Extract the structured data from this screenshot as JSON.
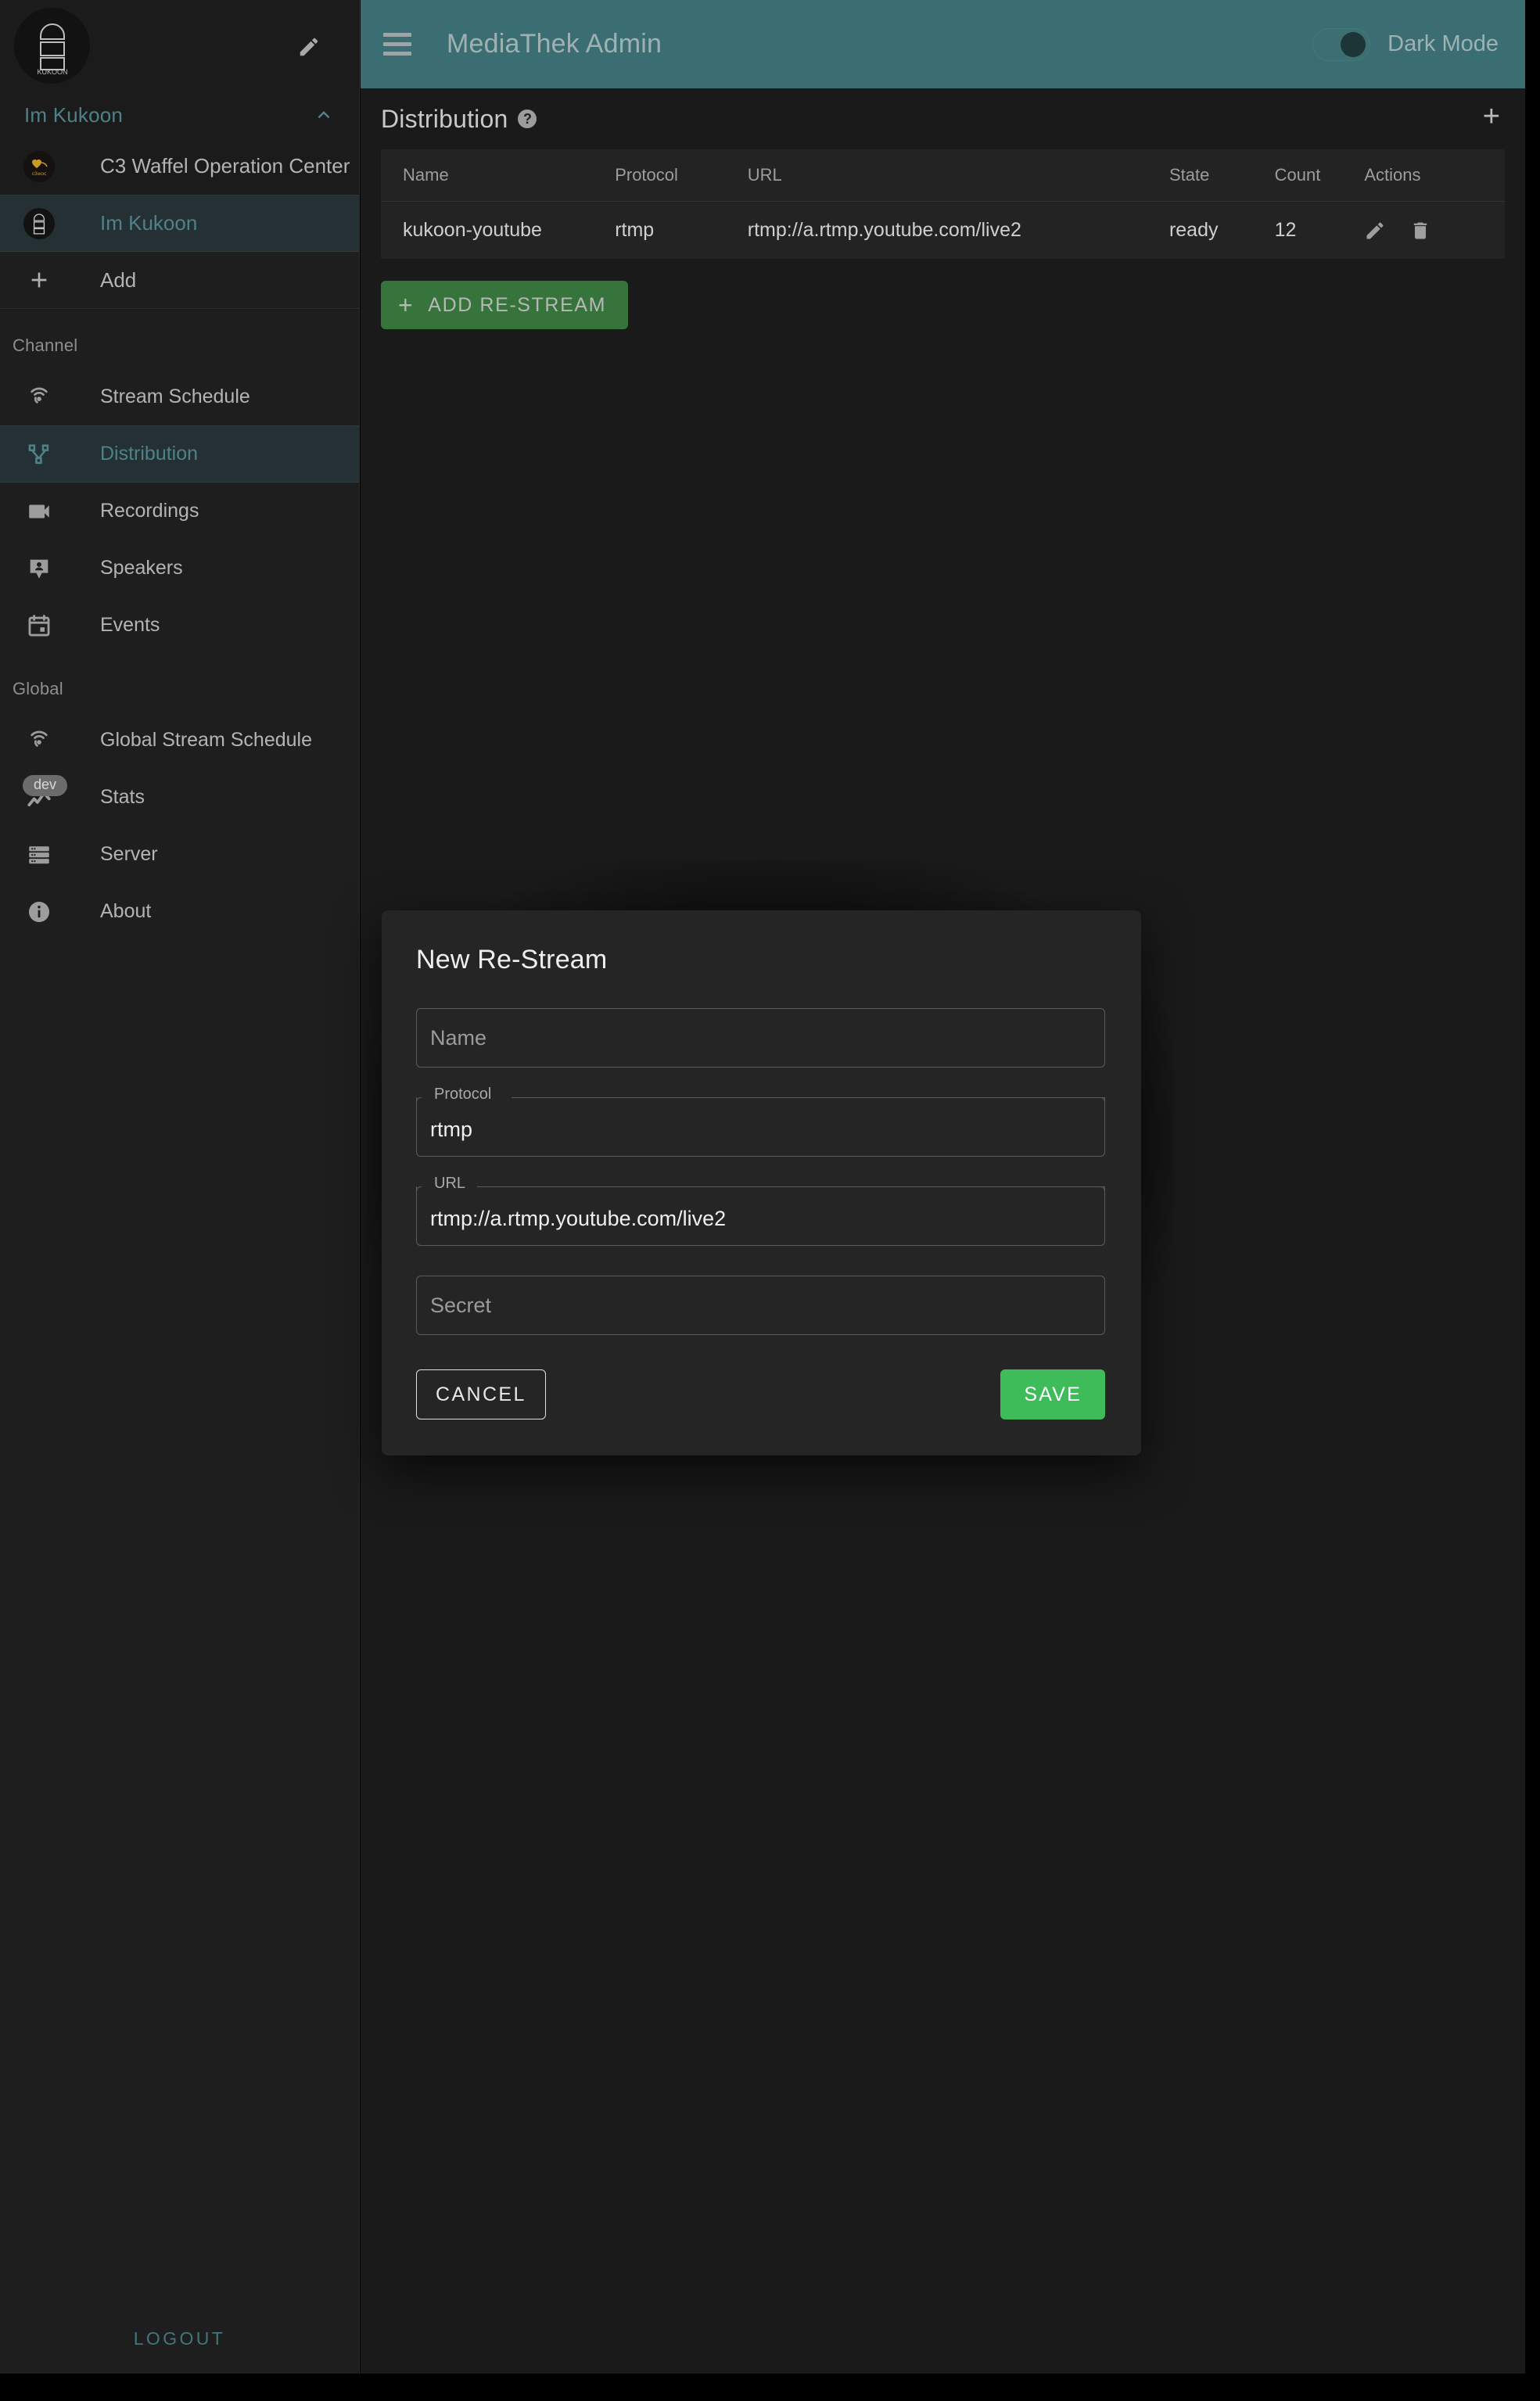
{
  "appbar": {
    "menu_icon": "hamburger-icon",
    "title": "MediaThek Admin",
    "dark_mode_label": "Dark Mode",
    "dark_mode_on": true,
    "accent_color": "#3a6e72"
  },
  "sidebar": {
    "brand_avatar_alt": "kukoon-logo",
    "edit_icon": "pencil-icon",
    "org_switcher": {
      "label": "Im Kukoon",
      "expanded": true,
      "chevron_icon": "chevron-up-icon"
    },
    "organizations": [
      {
        "label": "C3 Waffel Operation Center",
        "icon": "c3woc-avatar",
        "active": false
      },
      {
        "label": "Im Kukoon",
        "icon": "kukoon-avatar",
        "active": true
      }
    ],
    "add": {
      "label": "Add",
      "icon": "plus-icon"
    },
    "sections": [
      {
        "title": "Channel",
        "items": [
          {
            "label": "Stream Schedule",
            "icon": "broadcast-icon",
            "active": false
          },
          {
            "label": "Distribution",
            "icon": "distribution-icon",
            "active": true
          },
          {
            "label": "Recordings",
            "icon": "video-camera-icon",
            "active": false
          },
          {
            "label": "Speakers",
            "icon": "speaker-person-icon",
            "active": false
          },
          {
            "label": "Events",
            "icon": "calendar-icon",
            "active": false
          }
        ]
      },
      {
        "title": "Global",
        "items": [
          {
            "label": "Global Stream Schedule",
            "icon": "broadcast-icon",
            "active": false,
            "badge": null
          },
          {
            "label": "Stats",
            "icon": "trend-line-icon",
            "active": false,
            "badge": "dev"
          },
          {
            "label": "Server",
            "icon": "server-icon",
            "active": false,
            "badge": null
          },
          {
            "label": "About",
            "icon": "info-icon",
            "active": false,
            "badge": null
          }
        ]
      }
    ],
    "logout_label": "LOGOUT"
  },
  "page": {
    "title": "Distribution",
    "help_icon": "help-circle-icon",
    "help_glyph": "?",
    "add_icon": "plus-icon",
    "add_glyph": "+"
  },
  "table": {
    "columns": [
      "Name",
      "Protocol",
      "URL",
      "State",
      "Count",
      "Actions"
    ],
    "rows": [
      {
        "name": "kukoon-youtube",
        "protocol": "rtmp",
        "url": "rtmp://a.rtmp.youtube.com/live2",
        "state": "ready",
        "count": "12",
        "edit_icon": "pencil-icon",
        "delete_icon": "trash-icon"
      }
    ]
  },
  "add_restream_button": {
    "label": "ADD RE-STREAM",
    "plus": "+",
    "color": "#36743c"
  },
  "modal": {
    "title": "New Re-Stream",
    "fields": [
      {
        "key": "name",
        "label": "",
        "placeholder": "Name",
        "value": "",
        "floating": false
      },
      {
        "key": "protocol",
        "label": "Protocol",
        "placeholder": "",
        "value": "rtmp",
        "floating": true
      },
      {
        "key": "url",
        "label": "URL",
        "placeholder": "",
        "value": "rtmp://a.rtmp.youtube.com/live2",
        "floating": true
      },
      {
        "key": "secret",
        "label": "",
        "placeholder": "Secret",
        "value": "",
        "floating": false
      }
    ],
    "cancel_label": "CANCEL",
    "save_label": "SAVE",
    "save_color": "#3fbc5a"
  }
}
